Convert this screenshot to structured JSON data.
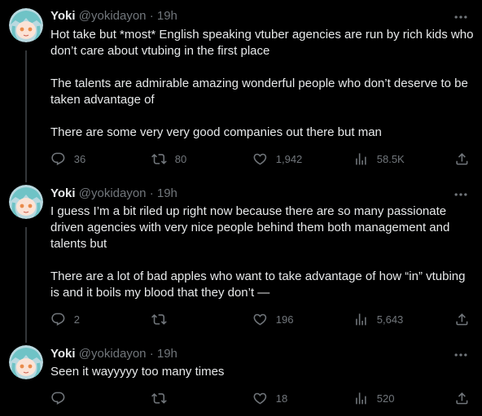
{
  "author": {
    "name": "Yoki",
    "handle": "@yokidayon",
    "separator": "·"
  },
  "tweets": [
    {
      "time": "19h",
      "paragraphs": [
        "Hot take but *most* English speaking vtuber agencies are run by rich kids who don’t care about vtubing in the first place",
        "The talents are admirable amazing wonderful people who don’t deserve to be taken advantage of",
        "There are some very very good companies out there but man"
      ],
      "replies": "36",
      "retweets": "80",
      "likes": "1,942",
      "views": "58.5K"
    },
    {
      "time": "19h",
      "paragraphs": [
        "I guess I’m a bit riled up right now because there are so many passionate driven agencies with very nice people behind them both management and talents but",
        "There are a lot of bad apples who want to take advantage of how “in” vtubing is and it boils my blood that they don’t —"
      ],
      "replies": "2",
      "retweets": "",
      "likes": "196",
      "views": "5,643"
    },
    {
      "time": "19h",
      "paragraphs": [
        "Seen it wayyyyy too many times"
      ],
      "replies": "",
      "retweets": "",
      "likes": "18",
      "views": "520"
    }
  ],
  "icons": {
    "reply": "reply-icon",
    "retweet": "retweet-icon",
    "like": "heart-icon",
    "views": "views-icon",
    "share": "share-icon",
    "more": "more-icon"
  },
  "colors": {
    "background": "#000000",
    "text": "#e7e9ea",
    "muted": "#71767b",
    "thread_line": "#333639"
  }
}
